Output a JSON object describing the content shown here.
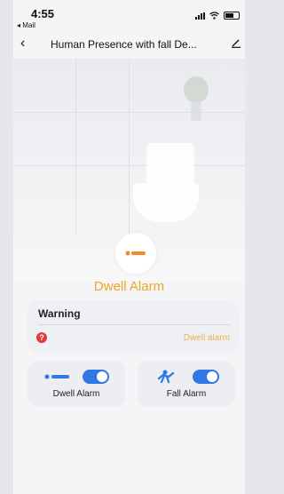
{
  "statusbar": {
    "time": "4:55",
    "back_app": "◂ Mail"
  },
  "nav": {
    "back_icon": "chevron-left-icon",
    "title": "Human Presence with fall De...",
    "edit_icon": "edit-icon"
  },
  "status": {
    "icon": "person-lying-icon",
    "label": "Dwell Alarm",
    "color": "#f0a526"
  },
  "warning": {
    "title": "Warning",
    "icon": "question-icon",
    "value": "Dwell alarm"
  },
  "toggles": [
    {
      "label": "Dwell Alarm",
      "icon": "person-lying-icon",
      "enabled": true
    },
    {
      "label": "Fall Alarm",
      "icon": "person-falling-icon",
      "enabled": true
    }
  ],
  "colors": {
    "accent": "#2f78e6",
    "warning_text": "#e9b450",
    "warning_icon": "#e03a3a"
  }
}
